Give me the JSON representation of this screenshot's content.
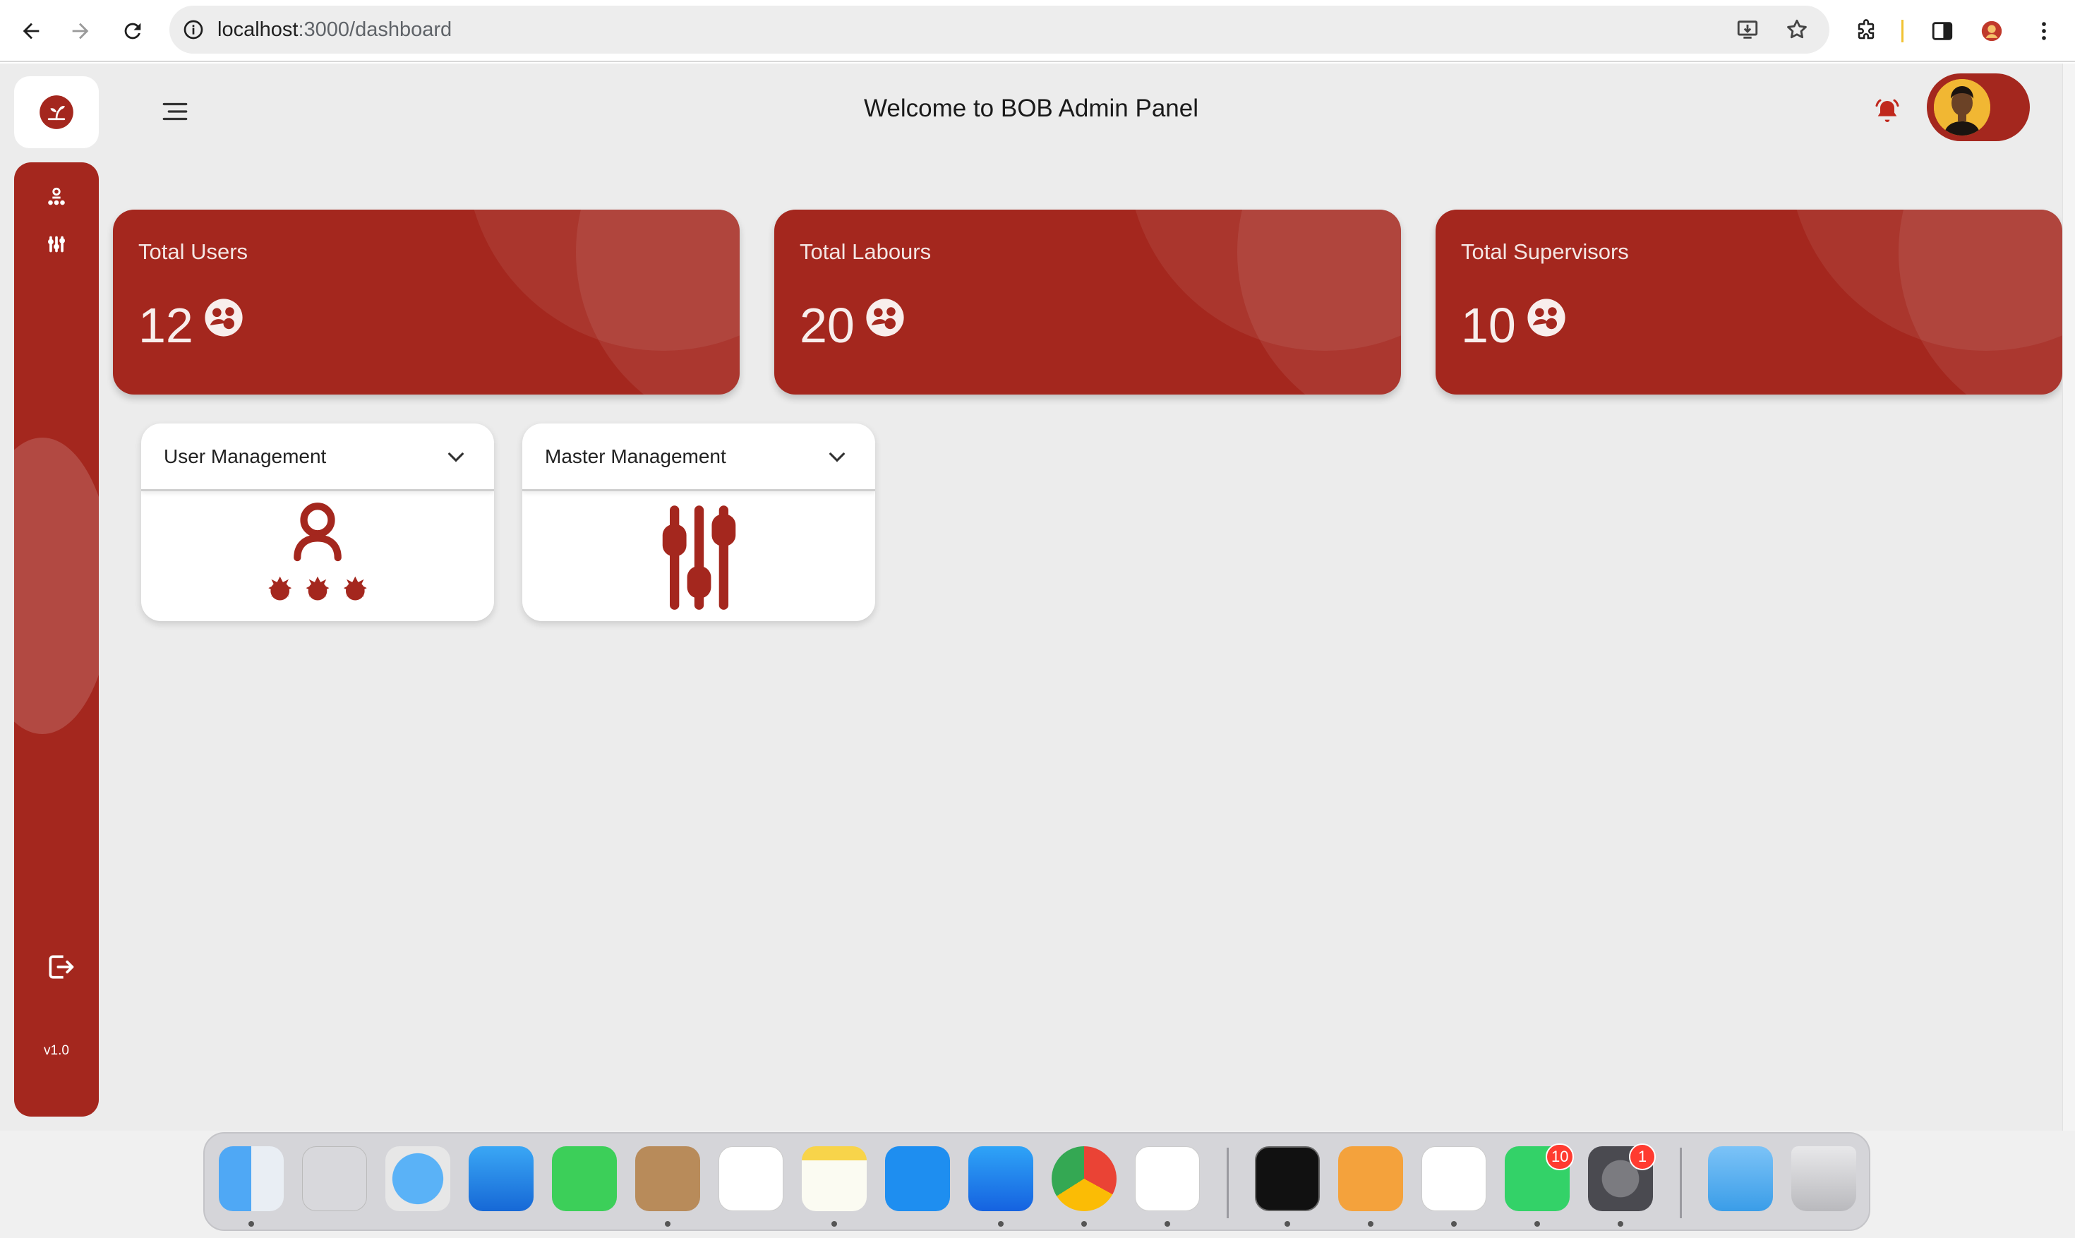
{
  "browser": {
    "url_host": "localhost",
    "url_path": ":3000/dashboard"
  },
  "header": {
    "title": "Welcome to BOB Admin Panel"
  },
  "sidebar": {
    "version": "v1.0"
  },
  "stats": [
    {
      "label": "Total Users",
      "value": "12"
    },
    {
      "label": "Total Labours",
      "value": "20"
    },
    {
      "label": "Total Supervisors",
      "value": "10"
    }
  ],
  "management": [
    {
      "label": "User Management",
      "icon": "user-hierarchy-icon"
    },
    {
      "label": "Master Management",
      "icon": "sliders-icon"
    }
  ],
  "dock": {
    "whatsapp_badge": "10",
    "settings_badge": "1"
  },
  "colors": {
    "brand": "#a4271e",
    "background": "#ececec"
  }
}
